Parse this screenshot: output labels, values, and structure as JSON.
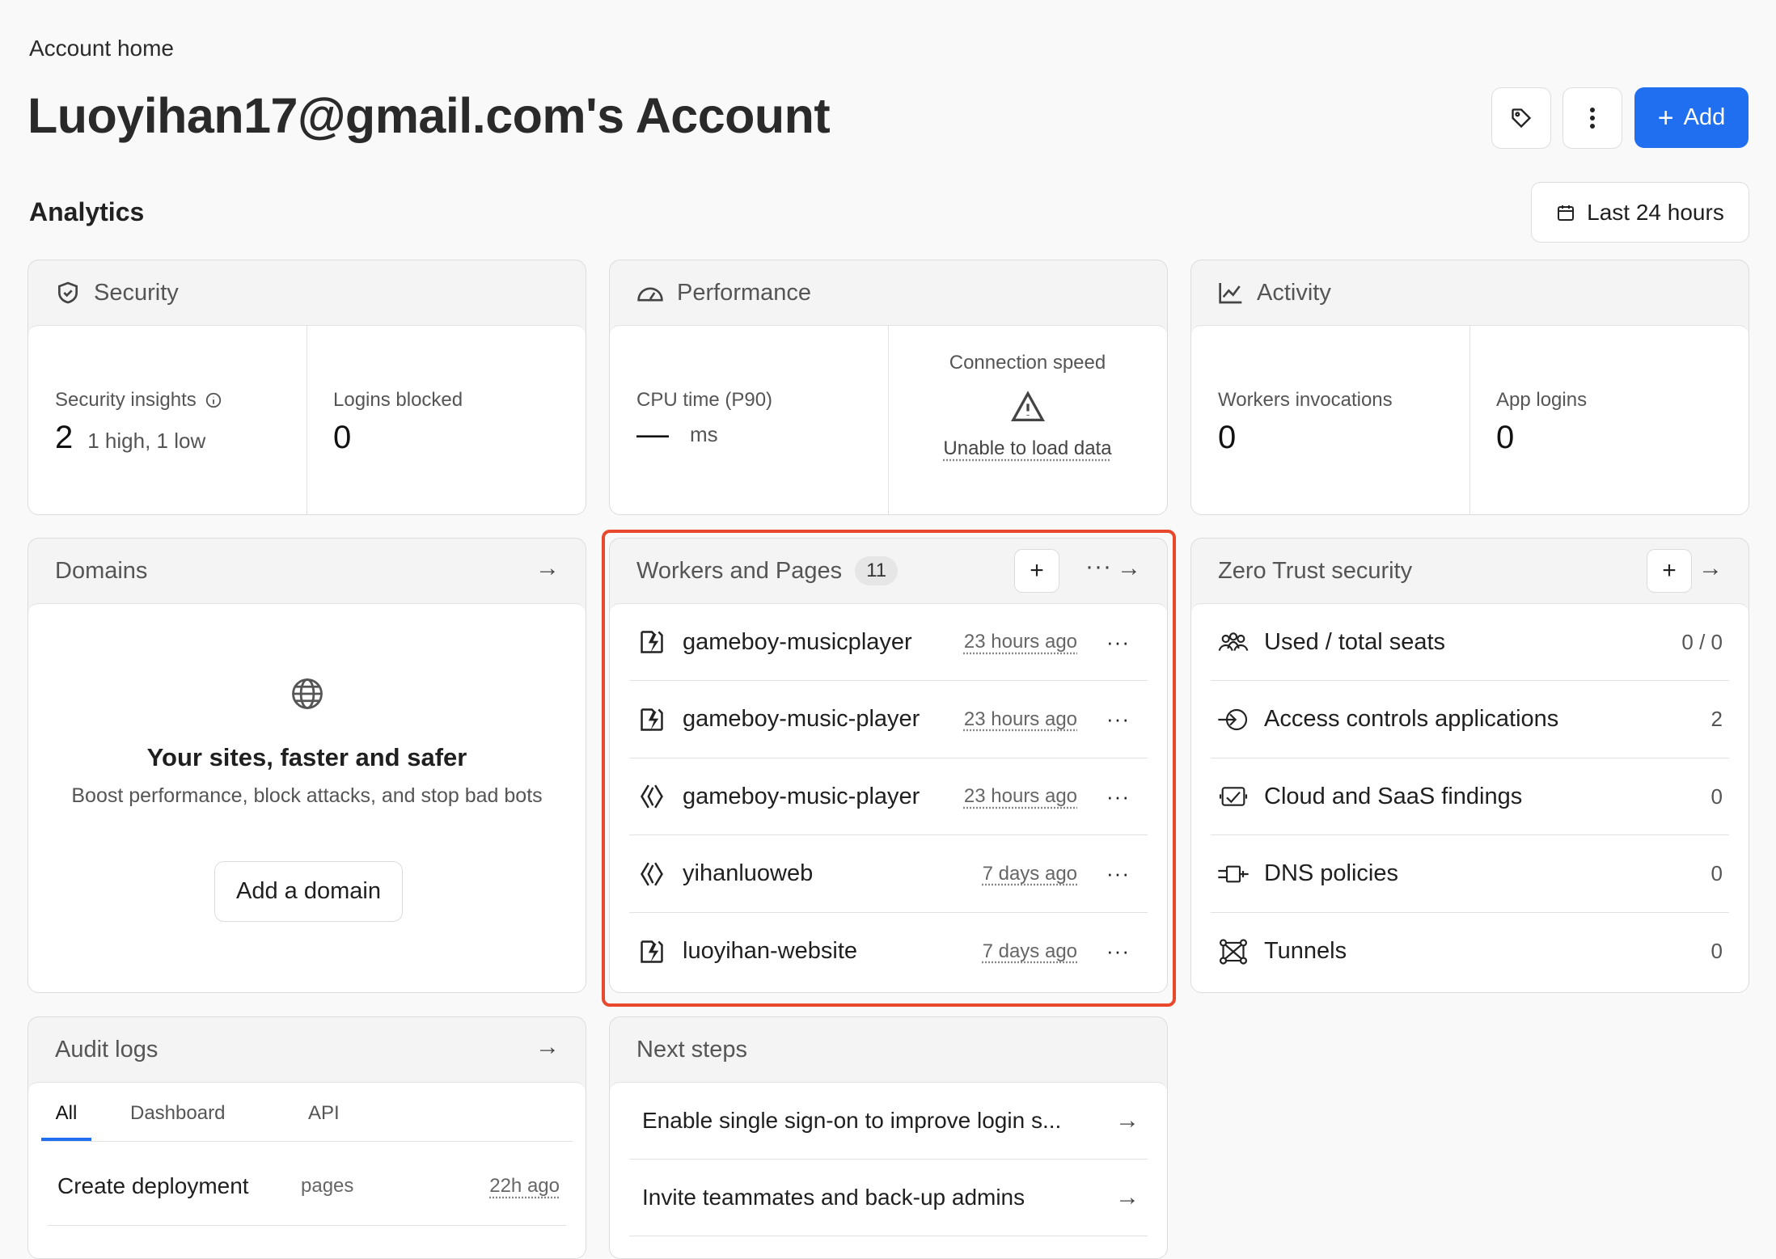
{
  "breadcrumb": "Account home",
  "page_title": "Luoyihan17@gmail.com's Account",
  "header_buttons": {
    "add_label": "Add"
  },
  "analytics": {
    "title": "Analytics",
    "range_label": "Last 24 hours"
  },
  "security": {
    "title": "Security",
    "insights_label": "Security insights",
    "insights_value": "2",
    "insights_detail": "1 high, 1 low",
    "logins_label": "Logins blocked",
    "logins_value": "0"
  },
  "performance": {
    "title": "Performance",
    "cpu_label": "CPU time (P90)",
    "cpu_value": "—",
    "cpu_unit": "ms",
    "conn_label": "Connection speed",
    "conn_error": "Unable to load data"
  },
  "activity": {
    "title": "Activity",
    "invocations_label": "Workers invocations",
    "invocations_value": "0",
    "app_logins_label": "App logins",
    "app_logins_value": "0"
  },
  "domains": {
    "title": "Domains",
    "empty_title": "Your sites, faster and safer",
    "empty_text": "Boost performance, block attacks, and stop bad bots",
    "add_label": "Add a domain"
  },
  "workers": {
    "title": "Workers and Pages",
    "count": "11",
    "items": [
      {
        "name": "gameboy-musicplayer",
        "time": "23 hours ago",
        "icon": "worker-icon"
      },
      {
        "name": "gameboy-music-player",
        "time": "23 hours ago",
        "icon": "worker-icon"
      },
      {
        "name": "gameboy-music-player",
        "time": "23 hours ago",
        "icon": "pages-icon"
      },
      {
        "name": "yihanluoweb",
        "time": "7 days ago",
        "icon": "pages-icon"
      },
      {
        "name": "luoyihan-website",
        "time": "7 days ago",
        "icon": "worker-icon"
      }
    ]
  },
  "zero_trust": {
    "title": "Zero Trust security",
    "items": [
      {
        "label": "Used / total seats",
        "value": "0 / 0",
        "icon": "users-icon"
      },
      {
        "label": "Access controls applications",
        "value": "2",
        "icon": "access-icon"
      },
      {
        "label": "Cloud and SaaS findings",
        "value": "0",
        "icon": "cloud-findings-icon"
      },
      {
        "label": "DNS policies",
        "value": "0",
        "icon": "dns-icon"
      },
      {
        "label": "Tunnels",
        "value": "0",
        "icon": "tunnel-icon"
      }
    ]
  },
  "audit_logs": {
    "title": "Audit logs",
    "tabs": [
      "All",
      "Dashboard",
      "API"
    ],
    "rows": [
      {
        "action": "Create deployment",
        "type": "pages",
        "time": "22h ago"
      }
    ]
  },
  "next_steps": {
    "title": "Next steps",
    "items": [
      "Enable single sign-on to improve login s...",
      "Invite teammates and back-up admins"
    ]
  },
  "colors": {
    "accent": "#1f6ff0",
    "highlight": "#e8482b"
  }
}
